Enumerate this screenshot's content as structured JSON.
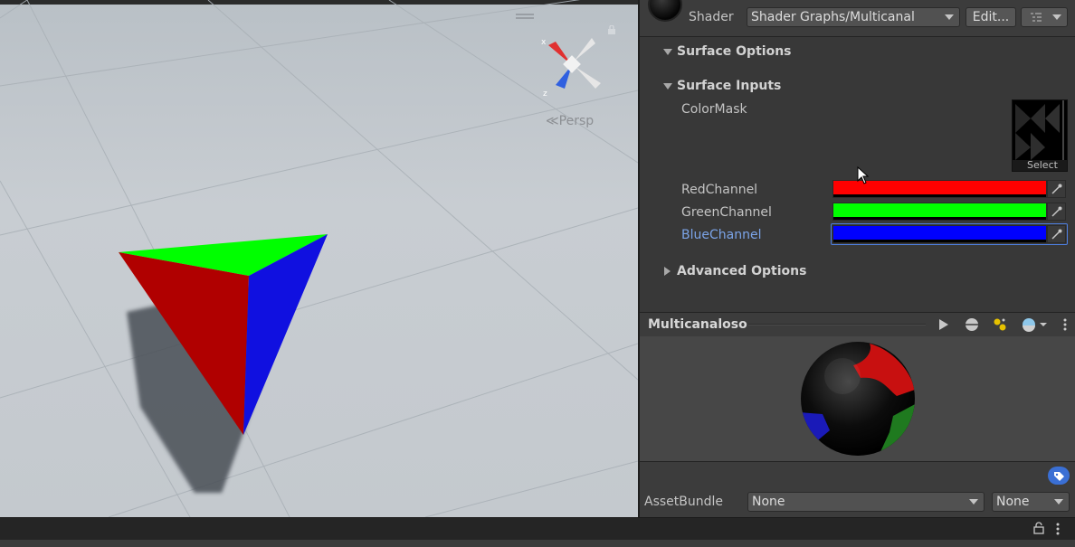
{
  "scene_view": {
    "projection_label": "Persp",
    "gizmo_axes": {
      "x": "x",
      "z": "z"
    }
  },
  "inspector": {
    "shader_label": "Shader",
    "shader_value": "Shader Graphs/Multicanal",
    "edit_button": "Edit...",
    "sections": {
      "surface_options": "Surface Options",
      "surface_inputs": "Surface Inputs",
      "advanced_options": "Advanced Options"
    },
    "properties": {
      "color_mask": "ColorMask",
      "texture_select": "Select",
      "red_channel": "RedChannel",
      "green_channel": "GreenChannel",
      "blue_channel": "BlueChannel"
    },
    "colors": {
      "red_channel": "#ff0000",
      "green_channel": "#00ff00",
      "blue_channel": "#0000ff",
      "active_label": "#7ba4e8"
    }
  },
  "preview": {
    "title": "Multicanaloso",
    "icons": [
      "play-icon",
      "sphere-mesh-icon",
      "light-icon",
      "sky-ball-icon",
      "more-menu-icon"
    ]
  },
  "asset_bundle": {
    "label": "AssetBundle",
    "name_value": "None",
    "variant_value": "None"
  }
}
